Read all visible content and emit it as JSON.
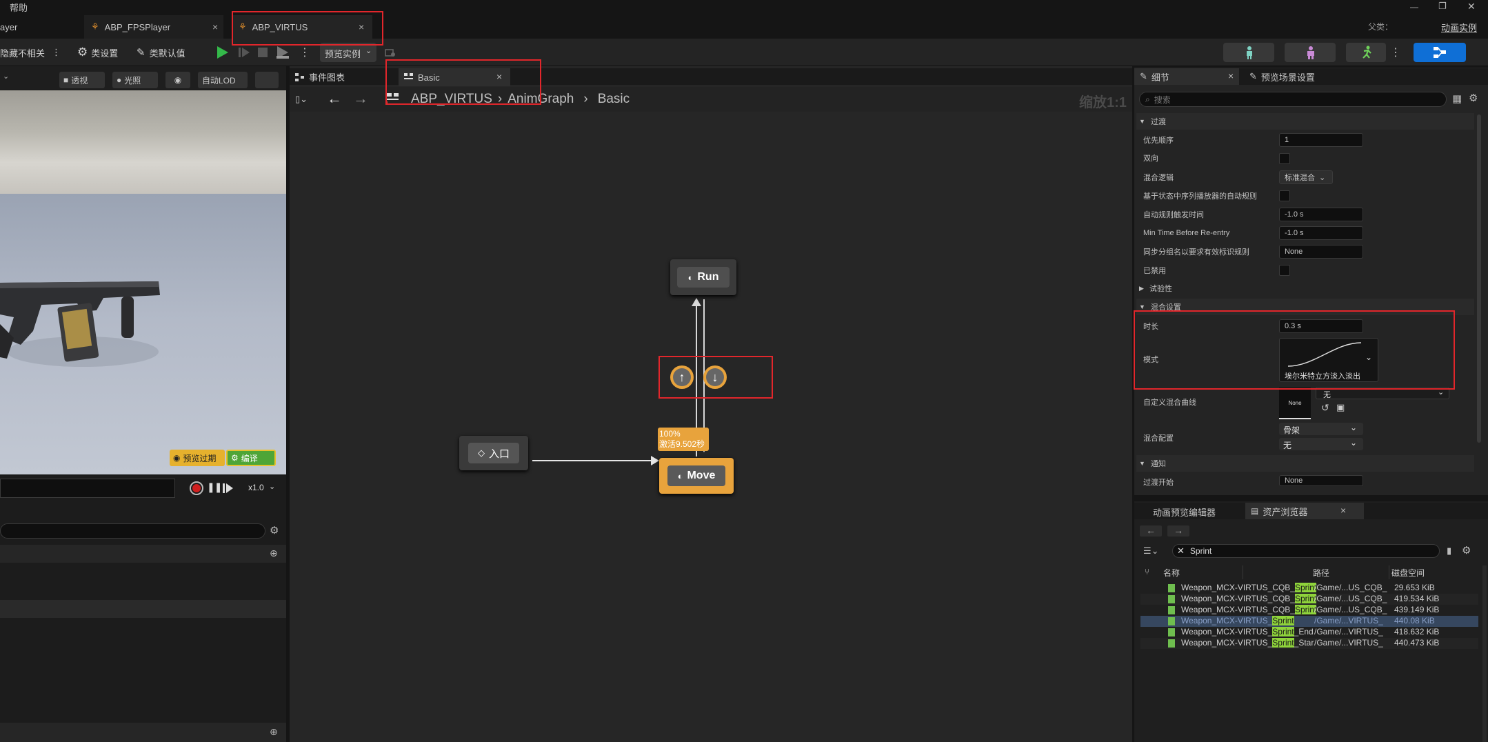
{
  "titlebar": {
    "menu_help": "帮助",
    "parent_label": "父类：",
    "parent_value": "动画实例",
    "minimize": "—",
    "restore": "❐",
    "close": "✕"
  },
  "tabs": [
    {
      "label": "ayer"
    },
    {
      "label": "ABP_FPSPlayer",
      "close": "×"
    },
    {
      "label": "ABP_VIRTUS",
      "close": "×"
    }
  ],
  "toolbar": {
    "hide_unrelated": "隐藏不相关",
    "class_settings": "类设置",
    "class_defaults": "类默认值",
    "preview_instance": "预览实例"
  },
  "viewport": {
    "perspective": "透视",
    "lighting": "光照",
    "auto_lod": "自动LOD",
    "preview_expired": "预览过期",
    "compile": "编译",
    "speed": "x1.0"
  },
  "graph_tabs": [
    {
      "label": "事件图表"
    },
    {
      "label": "Basic",
      "close": "×"
    }
  ],
  "breadcrumb": {
    "items": [
      "ABP_VIRTUS",
      "AnimGraph",
      "Basic"
    ],
    "zoom": "缩放1:1"
  },
  "graph": {
    "run_node": "Run",
    "move_node": "Move",
    "entry_node": "入口",
    "move_weight": "100%",
    "move_active": "激活9.502秒"
  },
  "details": {
    "tab_details": "细节",
    "tab_preview_scene": "预览场景设置",
    "search_placeholder": "搜索",
    "sections": {
      "transition": "过渡",
      "experimental": "试验性",
      "blend_settings": "混合设置",
      "notifications": "通知"
    },
    "props": {
      "priority_order": "优先顺序",
      "priority_value": "1",
      "bidirectional": "双向",
      "blend_logic": "混合逻辑",
      "blend_logic_value": "标准混合",
      "auto_rule": "基于状态中序列播放器的自动规则",
      "auto_rule_time": "自动规则触发时间",
      "auto_rule_time_value": "-1.0 s",
      "min_time_reentry": "Min Time Before Re-entry",
      "min_time_value": "-1.0 s",
      "sync_group": "同步分组名以要求有效标识规则",
      "sync_group_value": "None",
      "disabled": "已禁用",
      "duration": "时长",
      "duration_value": "0.3 s",
      "mode": "模式",
      "mode_value": "埃尔米特立方淡入淡出",
      "custom_curve": "自定义混合曲线",
      "custom_curve_thumb": "None",
      "custom_curve_value": "无",
      "blend_profile": "混合配置",
      "blend_profile_value1": "骨架",
      "blend_profile_value2": "无",
      "transition_start": "过渡开始",
      "transition_start_value": "None"
    }
  },
  "assets": {
    "tab_anim_preview": "动画预览编辑器",
    "tab_content": "资产浏览器",
    "close": "×",
    "search_value": "Sprint",
    "columns": [
      "名称",
      "路径",
      "磁盘空间"
    ],
    "rows": [
      {
        "pre": "Weapon_MCX-VIRTUS_CQB_",
        "hl": "Sprint",
        "post": "",
        "path": "/Game/...US_CQB_",
        "size": "29.653 KiB"
      },
      {
        "pre": "Weapon_MCX-VIRTUS_CQB_",
        "hl": "Sprint",
        "post": "",
        "path": "/Game/...US_CQB_",
        "size": "419.534 KiB"
      },
      {
        "pre": "Weapon_MCX-VIRTUS_CQB_",
        "hl": "Sprint",
        "post": "",
        "path": "/Game/...US_CQB_",
        "size": "439.149 KiB"
      },
      {
        "pre": "Weapon_MCX-VIRTUS_",
        "hl": "Sprint",
        "post": "",
        "path": "/Game/...VIRTUS_",
        "size": "440.08 KiB"
      },
      {
        "pre": "Weapon_MCX-VIRTUS_",
        "hl": "Sprint",
        "post": "_End",
        "path": "/Game/...VIRTUS_",
        "size": "418.632 KiB"
      },
      {
        "pre": "Weapon_MCX-VIRTUS_",
        "hl": "Sprint",
        "post": "_Star",
        "path": "/Game/...VIRTUS_",
        "size": "440.473 KiB"
      }
    ]
  },
  "colors": {
    "accent_blue": "#0f6fd6",
    "play_green": "#34b94a",
    "node_orange": "#e8a33c",
    "highlight_green": "#8fd43b",
    "annotation_red": "#e2262b"
  }
}
